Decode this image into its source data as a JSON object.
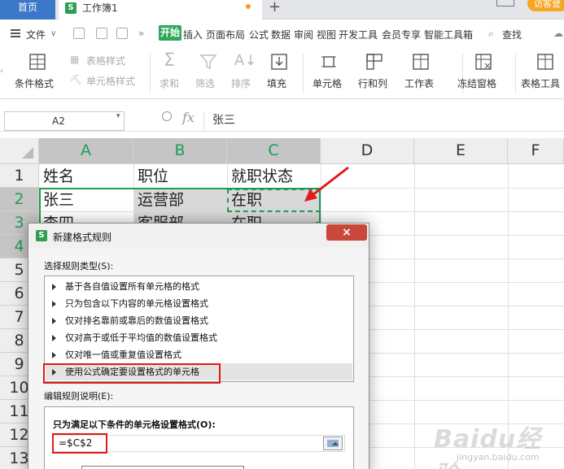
{
  "tabs": {
    "home": "首页",
    "workbook": "工作簿1",
    "add": "+",
    "login": "访客登"
  },
  "menu": {
    "file": "文件",
    "items": [
      "开始",
      "插入",
      "页面布局",
      "公式",
      "数据",
      "审阅",
      "视图",
      "开发工具",
      "会员专享",
      "智能工具箱"
    ],
    "search": "查找"
  },
  "ribbon": {
    "conditional_format": "条件格式",
    "table_style": "表格样式",
    "cell_style": "单元格样式",
    "sum": "求和",
    "filter": "筛选",
    "sort": "排序",
    "fill": "填充",
    "cell": "单元格",
    "row_col": "行和列",
    "worksheet": "工作表",
    "freeze": "冻结窗格",
    "table_tools": "表格工具"
  },
  "formula_bar": {
    "name_box": "A2",
    "fx": "fx",
    "value": "张三"
  },
  "grid": {
    "columns": [
      "A",
      "B",
      "C",
      "D",
      "E",
      "F"
    ],
    "rows": [
      "1",
      "2",
      "3",
      "4",
      "5",
      "6",
      "7",
      "8",
      "9",
      "10",
      "11",
      "12",
      "13"
    ],
    "cells": {
      "A1": "姓名",
      "B1": "职位",
      "C1": "就职状态",
      "A2": "张三",
      "B2": "运营部",
      "C2": "在职",
      "A3": "李四",
      "B3": "客服部",
      "C3": "在职"
    }
  },
  "dialog": {
    "title": "新建格式规则",
    "close": "×",
    "rule_type_label": "选择规则类型(S):",
    "rule_types": [
      "基于各自值设置所有单元格的格式",
      "只为包含以下内容的单元格设置格式",
      "仅对排名靠前或靠后的数值设置格式",
      "仅对高于或低于平均值的数值设置格式",
      "仅对唯一值或重复值设置格式",
      "使用公式确定要设置格式的单元格"
    ],
    "selected_rule": 5,
    "edit_label": "编辑规则说明(E):",
    "condition_label": "只为满足以下条件的单元格设置格式(O):",
    "formula": "=$C$2"
  },
  "watermark": {
    "brand": "Baidu经验",
    "url": "jingyan.baidu.com"
  },
  "colors": {
    "accent_green": "#1e9d54",
    "highlight_red": "#e21a1a",
    "tab_blue": "#3b78c8",
    "ribbon_green": "#2fa85a"
  }
}
